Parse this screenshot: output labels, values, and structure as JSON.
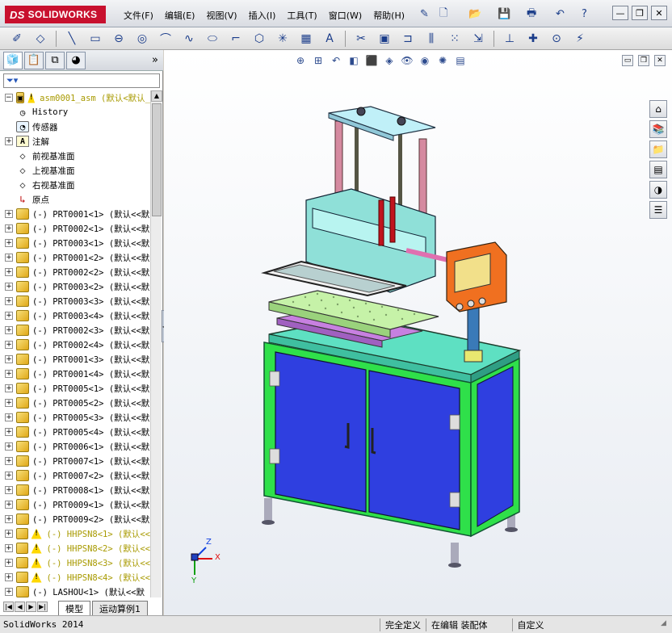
{
  "app": {
    "logo_ds": "DS",
    "logo_text": "SOLIDWORKS",
    "status_app": "SolidWorks 2014"
  },
  "menu": [
    "文件(F)",
    "编辑(E)",
    "视图(V)",
    "插入(I)",
    "工具(T)",
    "窗口(W)",
    "帮助(H)"
  ],
  "title_controls": {
    "minimize": "—",
    "restore": "❐",
    "close": "✕"
  },
  "feature_tree": {
    "filter_icon": "funnel-icon",
    "items": [
      {
        "expander": "−",
        "icon": "assembly",
        "warn": true,
        "label": "asm0001_asm  (默认<默认_",
        "style": "yellow"
      },
      {
        "expander": "",
        "icon": "history",
        "label": "History"
      },
      {
        "expander": "",
        "icon": "sensor",
        "label": "传感器"
      },
      {
        "expander": "+",
        "icon": "note",
        "label": "注解"
      },
      {
        "expander": "",
        "icon": "plane",
        "label": "前视基准面"
      },
      {
        "expander": "",
        "icon": "plane",
        "label": "上视基准面"
      },
      {
        "expander": "",
        "icon": "plane",
        "label": "右视基准面"
      },
      {
        "expander": "",
        "icon": "origin",
        "label": "原点"
      },
      {
        "expander": "+",
        "icon": "part",
        "label": "(-) PRT0001<1> (默认<<默"
      },
      {
        "expander": "+",
        "icon": "part",
        "label": "(-) PRT0002<1> (默认<<默"
      },
      {
        "expander": "+",
        "icon": "part",
        "label": "(-) PRT0003<1> (默认<<默"
      },
      {
        "expander": "+",
        "icon": "part",
        "label": "(-) PRT0001<2> (默认<<默"
      },
      {
        "expander": "+",
        "icon": "part",
        "label": "(-) PRT0002<2> (默认<<默"
      },
      {
        "expander": "+",
        "icon": "part",
        "label": "(-) PRT0003<2> (默认<<默"
      },
      {
        "expander": "+",
        "icon": "part",
        "label": "(-) PRT0003<3> (默认<<默"
      },
      {
        "expander": "+",
        "icon": "part",
        "label": "(-) PRT0003<4> (默认<<默"
      },
      {
        "expander": "+",
        "icon": "part",
        "label": "(-) PRT0002<3> (默认<<默"
      },
      {
        "expander": "+",
        "icon": "part",
        "label": "(-) PRT0002<4> (默认<<默"
      },
      {
        "expander": "+",
        "icon": "part",
        "label": "(-) PRT0001<3> (默认<<默"
      },
      {
        "expander": "+",
        "icon": "part",
        "label": "(-) PRT0001<4> (默认<<默"
      },
      {
        "expander": "+",
        "icon": "part",
        "label": "(-) PRT0005<1> (默认<<默"
      },
      {
        "expander": "+",
        "icon": "part",
        "label": "(-) PRT0005<2> (默认<<默"
      },
      {
        "expander": "+",
        "icon": "part",
        "label": "(-) PRT0005<3> (默认<<默"
      },
      {
        "expander": "+",
        "icon": "part",
        "label": "(-) PRT0005<4> (默认<<默"
      },
      {
        "expander": "+",
        "icon": "part",
        "label": "(-) PRT0006<1> (默认<<默"
      },
      {
        "expander": "+",
        "icon": "part",
        "label": "(-) PRT0007<1> (默认<<默"
      },
      {
        "expander": "+",
        "icon": "part",
        "label": "(-) PRT0007<2> (默认<<默"
      },
      {
        "expander": "+",
        "icon": "part",
        "label": "(-) PRT0008<1> (默认<<默"
      },
      {
        "expander": "+",
        "icon": "part",
        "label": "(-) PRT0009<1> (默认<<默"
      },
      {
        "expander": "+",
        "icon": "part",
        "label": "(-) PRT0009<2> (默认<<默"
      },
      {
        "expander": "+",
        "icon": "part",
        "warn": true,
        "label": "(-) HHPSN8<1> (默认<<",
        "style": "yellow"
      },
      {
        "expander": "+",
        "icon": "part",
        "warn": true,
        "label": "(-) HHPSN8<2> (默认<<",
        "style": "yellow"
      },
      {
        "expander": "+",
        "icon": "part",
        "warn": true,
        "label": "(-) HHPSN8<3> (默认<<",
        "style": "yellow"
      },
      {
        "expander": "+",
        "icon": "part",
        "warn": true,
        "label": "(-) HHPSN8<4> (默认<<",
        "style": "yellow"
      },
      {
        "expander": "+",
        "icon": "part",
        "label": "(-) LASHOU<1> (默认<<默"
      }
    ]
  },
  "bottom_tabs": [
    "模型",
    "运动算例1"
  ],
  "triad": {
    "x": "X",
    "y": "Y",
    "z": "Z"
  },
  "status": {
    "definition": "完全定义",
    "mode": "在编辑 装配体",
    "units": "自定义"
  },
  "colors": {
    "brand_red": "#c8102e",
    "cabinet_blue": "#2f3fe0",
    "frame_green": "#2fe04a",
    "top_cyan": "#5ee0c2",
    "hmi_orange": "#f07020"
  }
}
